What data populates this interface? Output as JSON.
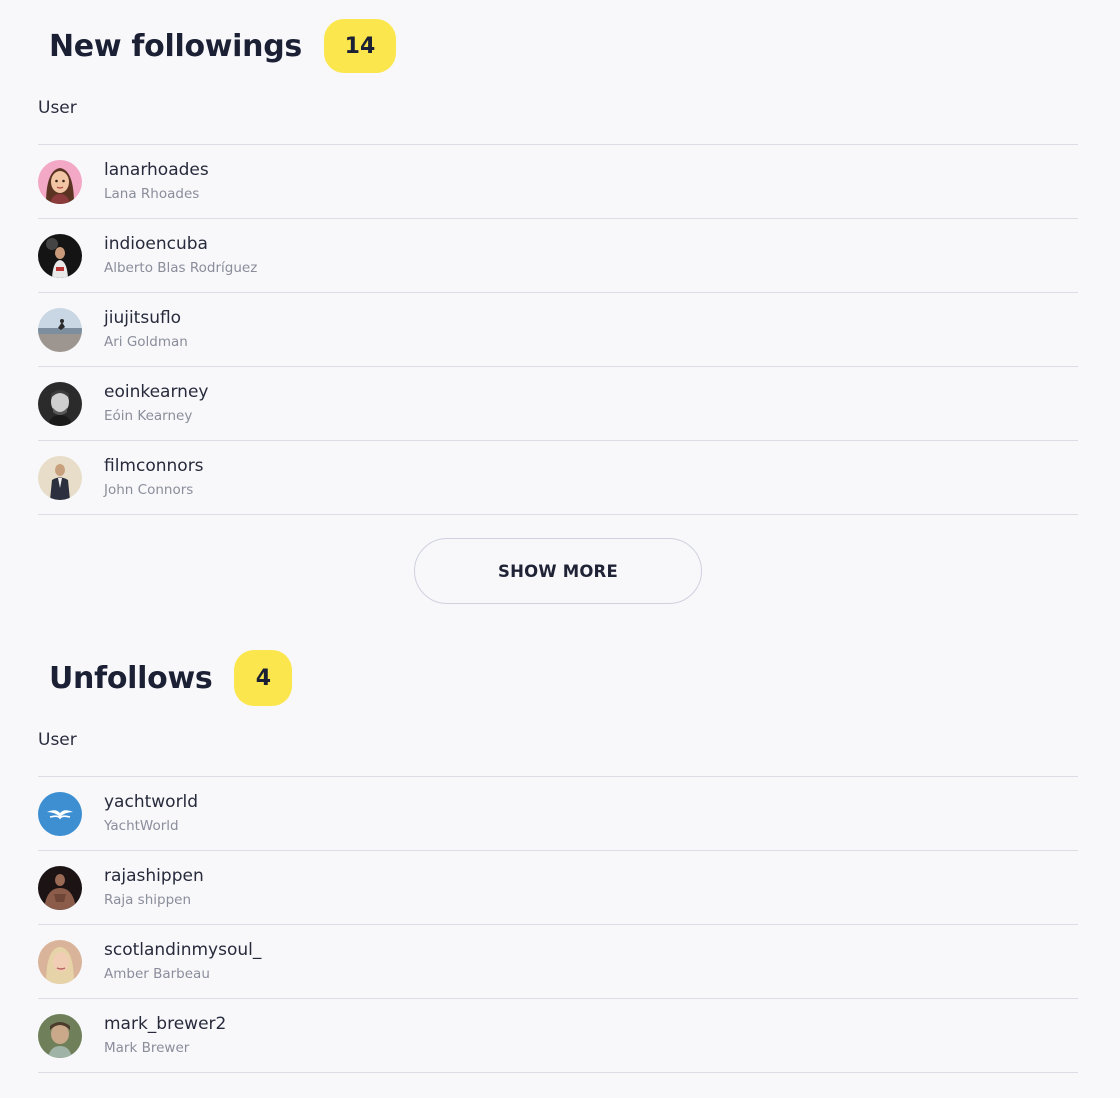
{
  "new_followings": {
    "title": "New followings",
    "count": "14",
    "column_header": "User",
    "users": [
      {
        "username": "lanarhoades",
        "name": "Lana Rhoades",
        "avatar": "avatar-cartoon-woman-icon"
      },
      {
        "username": "indioencuba",
        "name": "Alberto Blas Rodríguez",
        "avatar": "avatar-photo-man-dark-icon"
      },
      {
        "username": "jiujitsuflo",
        "name": "Ari Goldman",
        "avatar": "avatar-photo-beach-icon"
      },
      {
        "username": "eoinkearney",
        "name": "Eóin Kearney",
        "avatar": "avatar-photo-bw-man-icon"
      },
      {
        "username": "filmconnors",
        "name": "John Connors",
        "avatar": "avatar-photo-man-suit-icon"
      }
    ],
    "show_more_label": "SHOW MORE"
  },
  "unfollows": {
    "title": "Unfollows",
    "count": "4",
    "column_header": "User",
    "users": [
      {
        "username": "yachtworld",
        "name": "YachtWorld",
        "avatar": "avatar-yachtworld-logo-icon"
      },
      {
        "username": "rajashippen",
        "name": "Raja shippen",
        "avatar": "avatar-photo-man-muscular-icon"
      },
      {
        "username": "scotlandinmysoul_",
        "name": "Amber Barbeau",
        "avatar": "avatar-photo-woman-blonde-icon"
      },
      {
        "username": "mark_brewer2",
        "name": "Mark Brewer",
        "avatar": "avatar-photo-man-outdoor-icon"
      }
    ]
  },
  "colors": {
    "badge": "#fbe64d",
    "divider": "#dcdde6",
    "background": "#f8f8fb"
  }
}
